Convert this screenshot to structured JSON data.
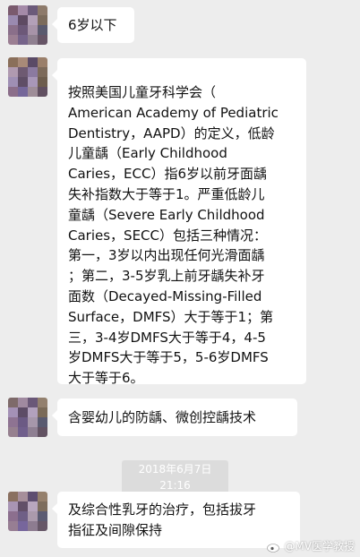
{
  "messages": [
    {
      "text": "6岁以下"
    },
    {
      "text": "按照美国儿童牙科学会（\nAmerican Academy of Pediatric\nDentistry，AAPD）的定义，低龄\n儿童龋（Early Childhood\nCaries，ECC）指6岁以前牙面龋\n失补指数大于等于1。严重低龄儿\n童龋（Severe Early Childhood\nCaries，SECC）包括三种情况：\n第一，3岁以内出现任何光滑面龋\n；第二，3-5岁乳上前牙龋失补牙\n面数（Decayed-Missing-Filled\nSurface，DMFS）大于等于1；第\n三，3-4岁DMFS大于等于4，4-5\n岁DMFS大于等于5，5-6岁DMFS\n大于等于6。"
    },
    {
      "text": "含婴幼儿的防龋、微创控龋技术"
    },
    {
      "text": "及综合性乳牙的治疗，包括拔牙\n指征及间隙保持"
    }
  ],
  "timestamp": "2018年6月7日 21:16",
  "watermark": "@MV医学教授",
  "colors": {
    "background": "#ededed",
    "bubble": "#ffffff",
    "timestamp_bg": "#dcdcdc"
  },
  "icons": {
    "avatar": "pixelated-avatar-icon",
    "watermark": "weibo-logo-icon"
  }
}
